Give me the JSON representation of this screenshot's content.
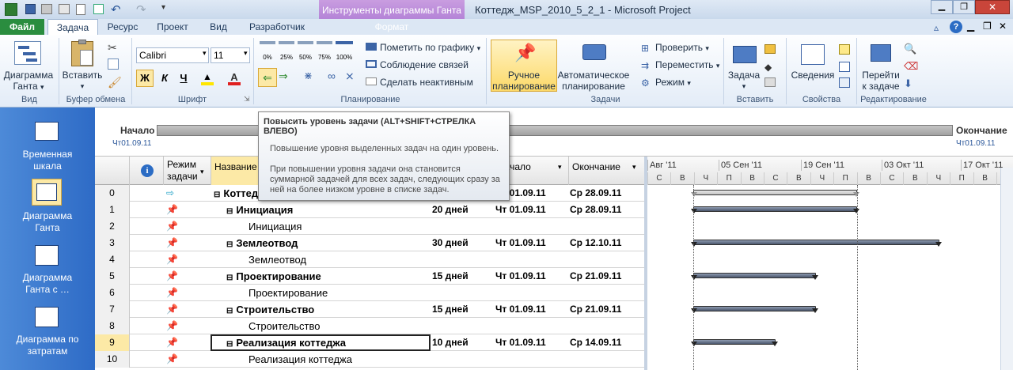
{
  "window": {
    "title": "Коттедж_MSP_2010_5_2_1 - Microsoft Project",
    "context_tab_header": "Инструменты диаграммы Ганта"
  },
  "tabs": [
    {
      "label": "Файл"
    },
    {
      "label": "Задача"
    },
    {
      "label": "Ресурс"
    },
    {
      "label": "Проект"
    },
    {
      "label": "Вид"
    },
    {
      "label": "Разработчик"
    },
    {
      "label": "Формат"
    }
  ],
  "ribbon": {
    "view": {
      "gantt_line1": "Диаграмма",
      "gantt_line2": "Ганта",
      "group": "Вид"
    },
    "clipboard": {
      "paste": "Вставить",
      "group": "Буфер обмена"
    },
    "font": {
      "name": "Calibri",
      "size": "11",
      "bold": "Ж",
      "italic": "К",
      "underline": "Ч",
      "group": "Шрифт"
    },
    "schedule": {
      "pct": [
        "0%",
        "25%",
        "50%",
        "75%",
        "100%"
      ],
      "mark": "Пометить по графику",
      "respect": "Соблюдение связей",
      "inactive": "Сделать неактивным",
      "group": "Планирование"
    },
    "tasks": {
      "manual_line1": "Ручное",
      "manual_line2": "планирование",
      "auto_line1": "Автоматическое",
      "auto_line2": "планирование",
      "inspect": "Проверить",
      "move": "Переместить",
      "mode": "Режим",
      "group": "Задачи"
    },
    "insert": {
      "task": "Задача",
      "group": "Вставить"
    },
    "properties": {
      "info": "Сведения",
      "group": "Свойства"
    },
    "editing": {
      "goto_line1": "Перейти",
      "goto_line2": "к задаче",
      "group": "Редактирование"
    }
  },
  "views": [
    {
      "line1": "Временная",
      "line2": "шкала"
    },
    {
      "line1": "Диаграмма",
      "line2": "Ганта"
    },
    {
      "line1": "Диаграмма",
      "line2": "Ганта с …"
    },
    {
      "line1": "Диаграмма по",
      "line2": "затратам"
    }
  ],
  "timeline": {
    "start_label": "Начало",
    "start_date": "Чт01.09.11",
    "finish_label": "Окончание",
    "finish_date": "Чт01.09.11"
  },
  "tooltip": {
    "title": "Повысить уровень задачи (ALT+SHIFT+СТРЕЛКА ВЛЕВО)",
    "p1": "Повышение уровня выделенных задач на один уровень.",
    "p2": "При повышении уровня задачи она становится суммарной задачей для всех задач, следующих сразу за ней на более низком уровне в списке задач."
  },
  "table": {
    "headers": {
      "info": "i",
      "mode_line1": "Режим",
      "mode_line2": "задачи",
      "name": "Название",
      "start": "Начало",
      "finish": "Окончание"
    },
    "rows": [
      {
        "id": "0",
        "name": "Коттедж",
        "duration": "",
        "start": "Чт 01.09.11",
        "finish": "Ср 28.09.11",
        "summary": true,
        "level": 0
      },
      {
        "id": "1",
        "name": "Инициация",
        "duration": "20 дней",
        "start": "Чт 01.09.11",
        "finish": "Ср 28.09.11",
        "summary": true,
        "level": 1
      },
      {
        "id": "2",
        "name": "Инициация",
        "duration": "",
        "start": "",
        "finish": "",
        "summary": false,
        "level": 2
      },
      {
        "id": "3",
        "name": "Землеотвод",
        "duration": "30 дней",
        "start": "Чт 01.09.11",
        "finish": "Ср 12.10.11",
        "summary": true,
        "level": 1
      },
      {
        "id": "4",
        "name": "Землеотвод",
        "duration": "",
        "start": "",
        "finish": "",
        "summary": false,
        "level": 2
      },
      {
        "id": "5",
        "name": "Проектирование",
        "duration": "15 дней",
        "start": "Чт 01.09.11",
        "finish": "Ср 21.09.11",
        "summary": true,
        "level": 1
      },
      {
        "id": "6",
        "name": "Проектирование",
        "duration": "",
        "start": "",
        "finish": "",
        "summary": false,
        "level": 2
      },
      {
        "id": "7",
        "name": "Строительство",
        "duration": "15 дней",
        "start": "Чт 01.09.11",
        "finish": "Ср 21.09.11",
        "summary": true,
        "level": 1
      },
      {
        "id": "8",
        "name": "Строительство",
        "duration": "",
        "start": "",
        "finish": "",
        "summary": false,
        "level": 2
      },
      {
        "id": "9",
        "name": "Реализация коттеджа",
        "duration": "10 дней",
        "start": "Чт 01.09.11",
        "finish": "Ср 14.09.11",
        "summary": true,
        "level": 1
      },
      {
        "id": "10",
        "name": "Реализация коттеджа",
        "duration": "",
        "start": "",
        "finish": "",
        "summary": false,
        "level": 2
      }
    ]
  },
  "chart_header": {
    "weeks": [
      "Авг '11",
      "05 Сен '11",
      "19 Сен '11",
      "03 Окт '11",
      "17 Окт '11"
    ],
    "days": [
      "С",
      "В",
      "Ч",
      "П",
      "В",
      "С",
      "В",
      "Ч",
      "П",
      "В",
      "С",
      "В",
      "Ч",
      "П",
      "В",
      "С",
      "В",
      "Ч",
      "П",
      "В",
      "С",
      "В"
    ]
  },
  "colors": {
    "accent": "#2b579a",
    "context": "#a36fd0",
    "selected": "#ffd96b",
    "bar": "#5a6a82"
  }
}
